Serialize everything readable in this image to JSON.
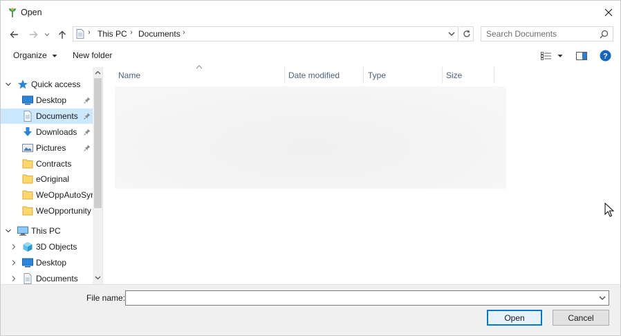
{
  "window": {
    "title": "Open"
  },
  "nav": {
    "breadcrumbs": [
      "This PC",
      "Documents"
    ],
    "search_placeholder": "Search Documents"
  },
  "commands": {
    "organize": "Organize",
    "new_folder": "New folder"
  },
  "tree": {
    "quick_access": "Quick access",
    "quick_items": [
      {
        "label": "Desktop",
        "pinned": true
      },
      {
        "label": "Documents",
        "pinned": true,
        "selected": true
      },
      {
        "label": "Downloads",
        "pinned": true
      },
      {
        "label": "Pictures",
        "pinned": true
      },
      {
        "label": "Contracts",
        "pinned": false
      },
      {
        "label": "eOriginal",
        "pinned": false
      },
      {
        "label": "WeOppAutoSyn",
        "pinned": false
      },
      {
        "label": "WeOpportunity",
        "pinned": false
      }
    ],
    "this_pc": "This PC",
    "pc_items": [
      {
        "label": "3D Objects"
      },
      {
        "label": "Desktop"
      },
      {
        "label": "Documents"
      }
    ]
  },
  "columns": [
    "Name",
    "Date modified",
    "Type",
    "Size"
  ],
  "bottom": {
    "file_name_label": "File name:",
    "file_name_value": "",
    "open_label": "Open",
    "cancel_label": "Cancel"
  },
  "colors": {
    "selection": "#cce8ff",
    "accent": "#0078d7",
    "folder": "#ffd86b",
    "header_text": "#4c607a"
  }
}
